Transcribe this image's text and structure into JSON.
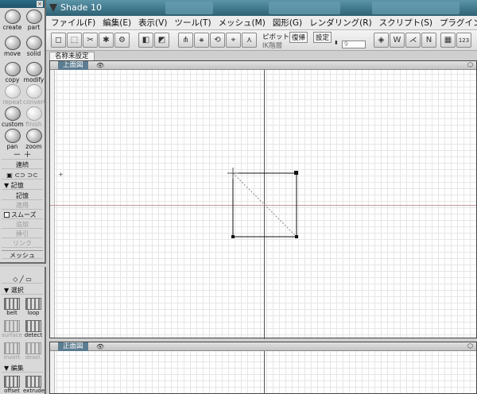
{
  "window": {
    "title": "Shade 10"
  },
  "menu": [
    "ファイル(F)",
    "編集(E)",
    "表示(V)",
    "ツール(T)",
    "メッシュ(M)",
    "図形(G)",
    "レンダリング(R)",
    "スクリプト(S)",
    "プラグイン(P)"
  ],
  "toolbar": {
    "pivot_label": "ピボット",
    "restore_label": "復帰",
    "settings_label": "設定",
    "ik_label": "IK階層",
    "ik_value": "9",
    "counter_label": "123"
  },
  "document_tab": "名称未設定",
  "views": {
    "top": {
      "title": "上面図"
    },
    "front": {
      "title": "正面図"
    }
  },
  "palette": {
    "close_label": "×",
    "tools": [
      {
        "label": "create"
      },
      {
        "label": "part"
      },
      {
        "label": "move"
      },
      {
        "label": "solid"
      },
      {
        "label": "copy"
      },
      {
        "label": "modify"
      },
      {
        "label": "repeat"
      },
      {
        "label": "convert"
      },
      {
        "label": "custom"
      },
      {
        "label": "finish"
      },
      {
        "label": "pan"
      },
      {
        "label": "zoom"
      }
    ],
    "continuous": "連続",
    "memory_header": "▼ 記憶",
    "memory": "記憶",
    "apply": "適用",
    "smooth": "スムーズ",
    "add": "追加",
    "subtract": "挿引",
    "link": "リンク",
    "mesh": "メッシュ"
  },
  "palette2": {
    "select_header": "▼ 選択",
    "tools": [
      {
        "label": "belt"
      },
      {
        "label": "loop"
      },
      {
        "label": "surface"
      },
      {
        "label": "detect"
      },
      {
        "label": "invert"
      },
      {
        "label": "desel."
      }
    ],
    "edit_header": "▼ 編集",
    "bottom_tools": [
      {
        "label": "offset"
      },
      {
        "label": "extrude"
      }
    ]
  }
}
